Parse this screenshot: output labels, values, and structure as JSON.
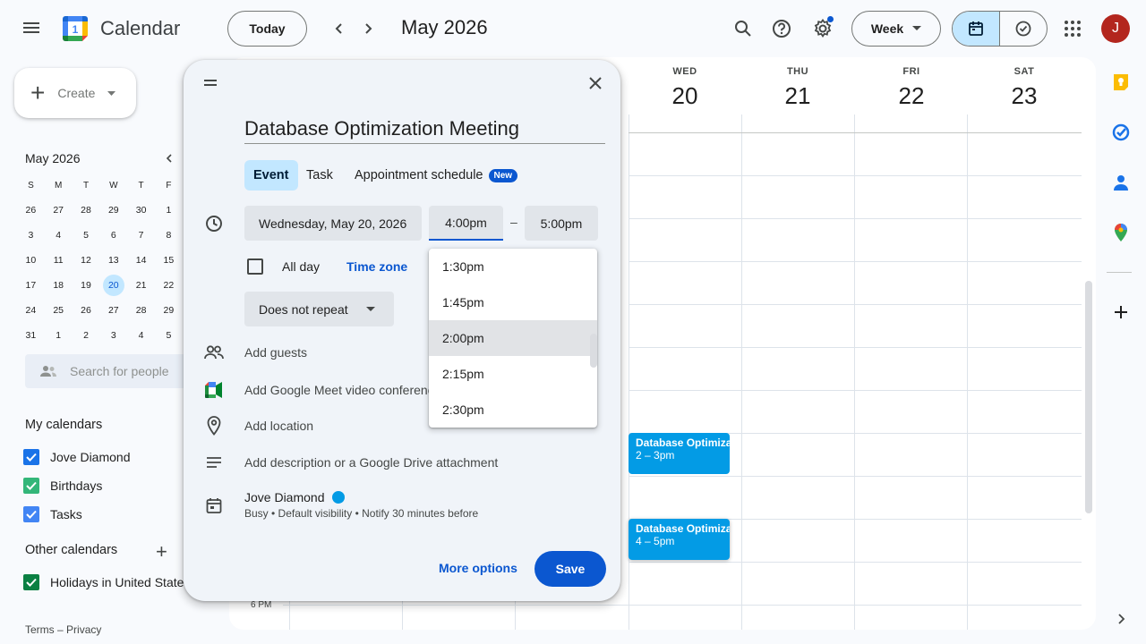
{
  "header": {
    "app_title": "Calendar",
    "logo_day": "1",
    "today_label": "Today",
    "month_label": "May 2026",
    "view_label": "Week",
    "avatar_initial": "J"
  },
  "sidebar": {
    "create_label": "Create",
    "mini_month": "May 2026",
    "dow": [
      "S",
      "M",
      "T",
      "W",
      "T",
      "F"
    ],
    "weeks": [
      [
        "26",
        "27",
        "28",
        "29",
        "30",
        "1"
      ],
      [
        "3",
        "4",
        "5",
        "6",
        "7",
        "8"
      ],
      [
        "10",
        "11",
        "12",
        "13",
        "14",
        "15"
      ],
      [
        "17",
        "18",
        "19",
        "20",
        "21",
        "22"
      ],
      [
        "24",
        "25",
        "26",
        "27",
        "28",
        "29"
      ],
      [
        "31",
        "1",
        "2",
        "3",
        "4",
        "5"
      ]
    ],
    "selected_day": "20",
    "search_people_placeholder": "Search for people",
    "my_calendars_title": "My calendars",
    "my_calendars": [
      {
        "name": "Jove Diamond",
        "color": "#1a73e8"
      },
      {
        "name": "Birthdays",
        "color": "#33b679"
      },
      {
        "name": "Tasks",
        "color": "#4285f4"
      }
    ],
    "other_calendars_title": "Other calendars",
    "other_calendars": [
      {
        "name": "Holidays in United States",
        "color": "#0b8043"
      }
    ],
    "footer_terms": "Terms",
    "footer_sep": "–",
    "footer_privacy": "Privacy"
  },
  "week": {
    "days": [
      {
        "dow": "WED",
        "num": "20"
      },
      {
        "dow": "THU",
        "num": "21"
      },
      {
        "dow": "FRI",
        "num": "22"
      },
      {
        "dow": "SAT",
        "num": "23"
      }
    ],
    "time_label": "6 PM",
    "events": [
      {
        "title": "Database Optimization Meeting",
        "time": "2 – 3pm"
      },
      {
        "title": "Database Optimization Meeting",
        "time": "4 – 5pm"
      }
    ]
  },
  "dialog": {
    "title_value": "Database Optimization Meeting",
    "tabs": [
      "Event",
      "Task",
      "Appointment schedule"
    ],
    "new_badge": "New",
    "date": "Wednesday, May 20, 2026",
    "start_time": "4:00pm",
    "dash": "–",
    "end_time": "5:00pm",
    "all_day_label": "All day",
    "time_zone_label": "Time zone",
    "repeat_label": "Does not repeat",
    "add_guests": "Add guests",
    "add_meet": "Add Google Meet video conferencing",
    "add_location": "Add location",
    "add_description": "Add description or a Google Drive attachment",
    "owner_name": "Jove Diamond",
    "owner_details": "Busy • Default visibility • Notify 30 minutes before",
    "more_options": "More options",
    "save": "Save"
  },
  "time_dropdown": {
    "options": [
      "1:30pm",
      "1:45pm",
      "2:00pm",
      "2:15pm",
      "2:30pm"
    ],
    "highlighted": "2:00pm"
  },
  "colors": {
    "accent": "#0b57d0",
    "event": "#039be5",
    "selected_bg": "#c2e7ff"
  }
}
